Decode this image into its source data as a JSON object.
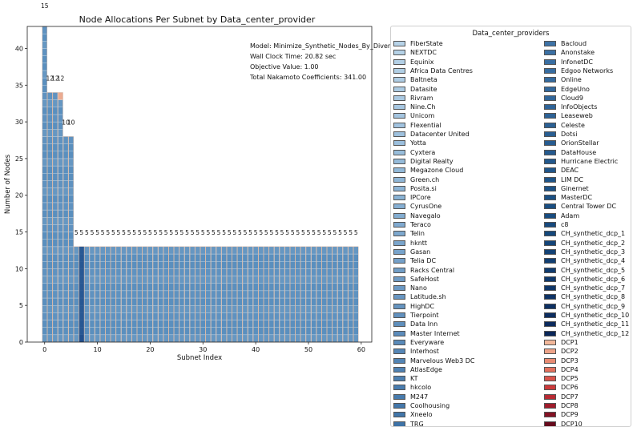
{
  "chart_data": {
    "type": "bar",
    "title": "Node Allocations Per Subnet by Data_center_provider",
    "xlabel": "Subnet Index",
    "ylabel": "Number of Nodes",
    "xlim": [
      -3.3,
      62
    ],
    "ylim": [
      0,
      43
    ],
    "x_ticks": [
      0,
      10,
      20,
      30,
      40,
      50,
      60
    ],
    "y_ticks": [
      0,
      5,
      10,
      15,
      20,
      25,
      30,
      35,
      40
    ],
    "annotations": [
      "Model: Minimize_Synthetic_Nodes_By_Diversific",
      "Wall Clock Time: 20.82 sec",
      "Objective Value: 1.00",
      "Total Nakamoto Coefficients: 341.00"
    ],
    "subnet_totals": [
      43,
      34,
      34,
      34,
      28,
      28,
      13,
      13,
      13,
      13,
      13,
      13,
      13,
      13,
      13,
      13,
      13,
      13,
      13,
      13,
      13,
      13,
      13,
      13,
      13,
      13,
      13,
      13,
      13,
      13,
      13,
      13,
      13,
      13,
      13,
      13,
      13,
      13,
      13,
      13,
      13,
      13,
      13,
      13,
      13,
      13,
      13,
      13,
      13,
      13,
      13,
      13,
      13,
      13,
      13,
      13,
      13,
      13,
      13,
      13
    ],
    "nakamoto_labels": [
      "15",
      "12",
      "12",
      "12",
      "10",
      "10",
      "5",
      "5",
      "5",
      "5",
      "5",
      "5",
      "5",
      "5",
      "5",
      "5",
      "5",
      "5",
      "5",
      "5",
      "5",
      "5",
      "5",
      "5",
      "5",
      "5",
      "5",
      "5",
      "5",
      "5",
      "5",
      "5",
      "5",
      "5",
      "5",
      "5",
      "5",
      "5",
      "5",
      "5",
      "5",
      "5",
      "5",
      "5",
      "5",
      "5",
      "5",
      "5",
      "5",
      "5",
      "5",
      "5",
      "5",
      "5",
      "5",
      "5",
      "5",
      "5",
      "5",
      "5"
    ],
    "bar_color": "#5a8fbe",
    "highlight_cells": [
      {
        "subnet": 3,
        "segment": 33,
        "color": "#eba98e"
      },
      {
        "subnet": 7,
        "segment": 0,
        "color": "#1f4e8c",
        "extends_to": 0
      }
    ],
    "legend": {
      "title": "Data_center_providers",
      "placement": "right",
      "column1": [
        {
          "name": "FiberState",
          "color": "#b7d3e8"
        },
        {
          "name": "NEXTDC",
          "color": "#b5d2e7"
        },
        {
          "name": "Equinix",
          "color": "#b3d0e6"
        },
        {
          "name": "Africa Data Centres",
          "color": "#b1cfe5"
        },
        {
          "name": "Baltneta",
          "color": "#afcde4"
        },
        {
          "name": "Datasite",
          "color": "#accbe3"
        },
        {
          "name": "Rivram",
          "color": "#aac9e2"
        },
        {
          "name": "Nine.Ch",
          "color": "#a7c7e1"
        },
        {
          "name": "Unicom",
          "color": "#a4c5e0"
        },
        {
          "name": "Flexential",
          "color": "#a1c3df"
        },
        {
          "name": "Datacenter United",
          "color": "#9ec1de"
        },
        {
          "name": "Yotta",
          "color": "#9bbfdd"
        },
        {
          "name": "Cyxtera",
          "color": "#98bddb"
        },
        {
          "name": "Digital Realty",
          "color": "#95bbda"
        },
        {
          "name": "Megazone Cloud",
          "color": "#92b9d9"
        },
        {
          "name": "Green.ch",
          "color": "#8fb6d7"
        },
        {
          "name": "Posita.si",
          "color": "#8cb4d6"
        },
        {
          "name": "IPCore",
          "color": "#89b2d4"
        },
        {
          "name": "CyrusOne",
          "color": "#86afd3"
        },
        {
          "name": "Navegalo",
          "color": "#83add1"
        },
        {
          "name": "Teraco",
          "color": "#80aad0"
        },
        {
          "name": "Telin",
          "color": "#7da8ce"
        },
        {
          "name": "hkntt",
          "color": "#7aa5cc"
        },
        {
          "name": "Gasan",
          "color": "#77a3cb"
        },
        {
          "name": "Telia DC",
          "color": "#74a0c9"
        },
        {
          "name": "Racks Central",
          "color": "#719ec7"
        },
        {
          "name": "SafeHost",
          "color": "#6e9bc5"
        },
        {
          "name": "Nano",
          "color": "#6b99c4"
        },
        {
          "name": "Latitude.sh",
          "color": "#6896c2"
        },
        {
          "name": "HighDC",
          "color": "#6594c0"
        },
        {
          "name": "Tierpoint",
          "color": "#6291be"
        },
        {
          "name": "Data Inn",
          "color": "#5f8fbc"
        },
        {
          "name": "Master Internet",
          "color": "#5c8cbb"
        },
        {
          "name": "Everyware",
          "color": "#598ab9"
        },
        {
          "name": "Interhost",
          "color": "#5687b7"
        },
        {
          "name": "Marvelous Web3 DC",
          "color": "#5385b5"
        },
        {
          "name": "AtlasEdge",
          "color": "#5082b3"
        },
        {
          "name": "KT",
          "color": "#4d80b1"
        },
        {
          "name": "hkcolo",
          "color": "#4a7daf"
        },
        {
          "name": "M247",
          "color": "#477bad"
        },
        {
          "name": "Coolhousing",
          "color": "#4478ab"
        },
        {
          "name": "Xneelo",
          "color": "#4176a9"
        },
        {
          "name": "TRG",
          "color": "#3e73a7"
        }
      ],
      "column2": [
        {
          "name": "Bacloud",
          "color": "#3d72a6"
        },
        {
          "name": "Anonstake",
          "color": "#3b70a4"
        },
        {
          "name": "InfonetDC",
          "color": "#396ea2"
        },
        {
          "name": "Edgoo Networks",
          "color": "#376ca0"
        },
        {
          "name": "Online",
          "color": "#356a9e"
        },
        {
          "name": "EdgeUno",
          "color": "#33689c"
        },
        {
          "name": "Cloud9",
          "color": "#31669a"
        },
        {
          "name": "InfoObjects",
          "color": "#2f6498"
        },
        {
          "name": "Leaseweb",
          "color": "#2d6296"
        },
        {
          "name": "Celeste",
          "color": "#2b6094"
        },
        {
          "name": "Dotsi",
          "color": "#295e92"
        },
        {
          "name": "OrionStellar",
          "color": "#275c90"
        },
        {
          "name": "DataHouse",
          "color": "#255a8e"
        },
        {
          "name": "Hurricane Electric",
          "color": "#23588c"
        },
        {
          "name": "DEAC",
          "color": "#21568a"
        },
        {
          "name": "LIM DC",
          "color": "#1f5488"
        },
        {
          "name": "Ginernet",
          "color": "#1d5286"
        },
        {
          "name": "MasterDC",
          "color": "#1b5084"
        },
        {
          "name": "Central Tower DC",
          "color": "#1a4e82"
        },
        {
          "name": "Adam",
          "color": "#184c80"
        },
        {
          "name": "c8",
          "color": "#174a7e"
        },
        {
          "name": "CH_synthetic_dcp_1",
          "color": "#15487b"
        },
        {
          "name": "CH_synthetic_dcp_2",
          "color": "#144578"
        },
        {
          "name": "CH_synthetic_dcp_3",
          "color": "#134275"
        },
        {
          "name": "CH_synthetic_dcp_4",
          "color": "#123f72"
        },
        {
          "name": "CH_synthetic_dcp_5",
          "color": "#113c6f"
        },
        {
          "name": "CH_synthetic_dcp_6",
          "color": "#10396c"
        },
        {
          "name": "CH_synthetic_dcp_7",
          "color": "#0f3669"
        },
        {
          "name": "CH_synthetic_dcp_8",
          "color": "#0e3366"
        },
        {
          "name": "CH_synthetic_dcp_9",
          "color": "#0d3063"
        },
        {
          "name": "CH_synthetic_dcp_10",
          "color": "#0c2d60"
        },
        {
          "name": "CH_synthetic_dcp_11",
          "color": "#0b2a5d"
        },
        {
          "name": "CH_synthetic_dcp_12",
          "color": "#0a275a"
        },
        {
          "name": "DCP1",
          "color": "#f2b79a"
        },
        {
          "name": "DCP2",
          "color": "#eda389"
        },
        {
          "name": "DCP3",
          "color": "#e88b73"
        },
        {
          "name": "DCP4",
          "color": "#e2705d"
        },
        {
          "name": "DCP5",
          "color": "#d9534b"
        },
        {
          "name": "DCP6",
          "color": "#cb3a3b"
        },
        {
          "name": "DCP7",
          "color": "#b82a33"
        },
        {
          "name": "DCP8",
          "color": "#a01c2b"
        },
        {
          "name": "DCP9",
          "color": "#841224"
        },
        {
          "name": "DCP10",
          "color": "#66091c"
        }
      ]
    }
  }
}
